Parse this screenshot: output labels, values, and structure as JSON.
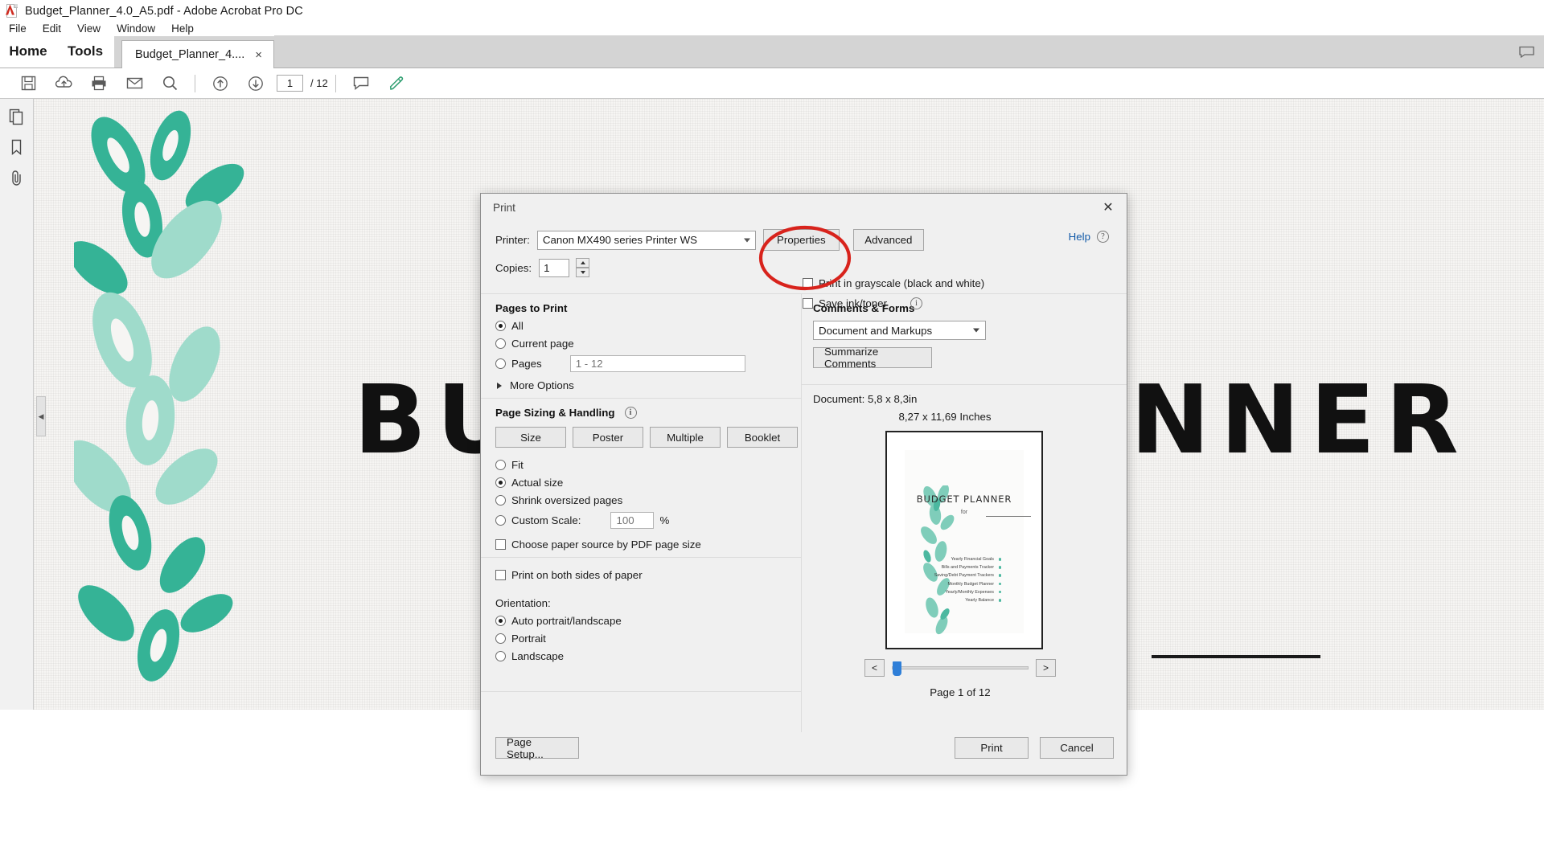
{
  "window": {
    "title": "Budget_Planner_4.0_A5.pdf - Adobe Acrobat Pro DC",
    "app_icon": "pdf-file-icon"
  },
  "menubar": {
    "items": [
      "File",
      "Edit",
      "View",
      "Window",
      "Help"
    ]
  },
  "tabs": {
    "home": "Home",
    "tools": "Tools",
    "document": "Budget_Planner_4....",
    "close_glyph": "×"
  },
  "toolbar": {
    "page_number": "1",
    "page_total": "/ 12",
    "icons": [
      "save-icon",
      "cloud-upload-icon",
      "print-icon",
      "email-icon",
      "search-icon",
      "previous-page-icon",
      "next-page-icon",
      "comment-icon",
      "highlight-icon"
    ]
  },
  "sidebar": {
    "icons": [
      "page-thumbnails-icon",
      "bookmarks-icon",
      "attachments-icon"
    ]
  },
  "document": {
    "big_title": "BUDGET PLANNER",
    "collapse_glyph": "◀"
  },
  "dialog": {
    "title": "Print",
    "close_glyph": "✕",
    "printer_label": "Printer:",
    "printer_value": "Canon MX490 series Printer WS",
    "properties_button": "Properties",
    "advanced_button": "Advanced",
    "help_link": "Help",
    "help_icon": "help-circle-icon",
    "copies_label": "Copies:",
    "copies_value": "1",
    "grayscale_label": "Print in grayscale (black and white)",
    "grayscale_checked": false,
    "saveink_label": "Save ink/toner",
    "saveink_checked": false,
    "saveink_info_icon": "info-circle-icon",
    "pages_to_print": {
      "heading": "Pages to Print",
      "options": [
        {
          "label": "All",
          "selected": true
        },
        {
          "label": "Current page",
          "selected": false
        },
        {
          "label": "Pages",
          "selected": false
        }
      ],
      "pages_placeholder": "1 - 12",
      "more_options": "More Options"
    },
    "page_sizing": {
      "heading": "Page Sizing & Handling",
      "info_icon": "info-circle-icon",
      "buttons": [
        "Size",
        "Poster",
        "Multiple",
        "Booklet"
      ],
      "options": [
        {
          "label": "Fit",
          "selected": false
        },
        {
          "label": "Actual size",
          "selected": true
        },
        {
          "label": "Shrink oversized pages",
          "selected": false
        },
        {
          "label": "Custom Scale:",
          "selected": false
        }
      ],
      "custom_scale_value": "100",
      "percent_symbol": "%",
      "paper_source_label": "Choose paper source by PDF page size",
      "paper_source_checked": false,
      "both_sides_label": "Print on both sides of paper",
      "both_sides_checked": false,
      "orientation_heading": "Orientation:",
      "orientation_options": [
        {
          "label": "Auto portrait/landscape",
          "selected": true
        },
        {
          "label": "Portrait",
          "selected": false
        },
        {
          "label": "Landscape",
          "selected": false
        }
      ]
    },
    "comments_forms": {
      "heading": "Comments & Forms",
      "selected": "Document and Markups",
      "summarize_button": "Summarize Comments"
    },
    "preview": {
      "document_label": "Document: 5,8 x 8,3in",
      "paper_dims": "8,27 x 11,69 Inches",
      "prev_glyph": "<",
      "next_glyph": ">",
      "page_of": "Page 1 of 12",
      "thumb_title": "BUDGET PLANNER",
      "thumb_for": "for",
      "thumb_list": [
        "Yearly Financial Goals",
        "Bills and Payments Tracker",
        "Saving/Debt Payment Trackers",
        "Monthly Budget Planner",
        "Yearly/Monthly Expenses",
        "Yearly Balance"
      ]
    },
    "footer": {
      "page_setup": "Page Setup...",
      "print": "Print",
      "cancel": "Cancel"
    }
  },
  "annotation": {
    "type": "red-ellipse-highlight",
    "target": "properties-button",
    "color": "#d8231c"
  },
  "colors": {
    "accent_teal": "#4cb8a0",
    "link_blue": "#1159a8",
    "slider_blue": "#2f7fd8",
    "annotation_red": "#d8231c"
  }
}
